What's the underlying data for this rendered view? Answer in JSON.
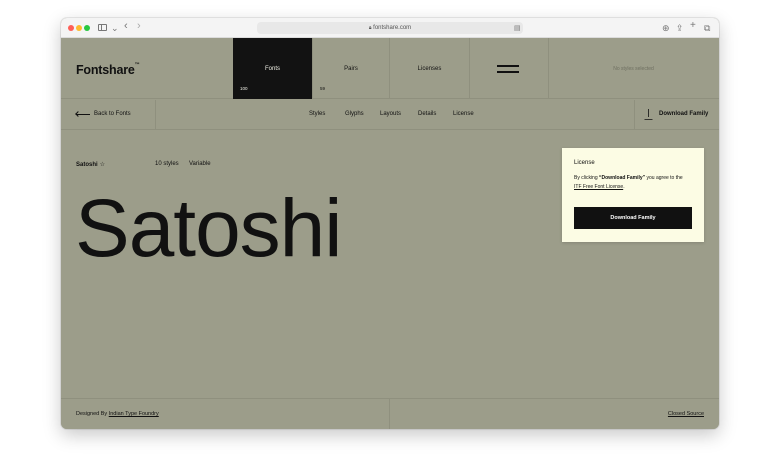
{
  "browser": {
    "url": "fontshare.com"
  },
  "nav": {
    "logo": "Fontshare",
    "logo_mark": "™",
    "fonts_label": "Fonts",
    "fonts_count": "100",
    "pairs_label": "Pairs",
    "pairs_count": "59",
    "licenses_label": "Licenses",
    "no_styles": "No styles selected"
  },
  "subnav": {
    "back_label": "Back to Fonts",
    "tabs": [
      "Styles",
      "Glyphs",
      "Layouts",
      "Details",
      "License"
    ],
    "download_family": "Download Family"
  },
  "font": {
    "name": "Satoshi",
    "styles": "10 styles",
    "variable": "Variable",
    "specimen": "Satoshi"
  },
  "footer": {
    "designed_by": "Designed By",
    "foundry": "Indian Type Foundry",
    "closed_source": "Closed Source"
  },
  "popup": {
    "title": "License",
    "text_pre": "By clicking ",
    "text_bold": "“Download Family”",
    "text_post": " you agree to the",
    "license_link": "ITF Free Font License",
    "text_end": ".",
    "button": "Download Family"
  },
  "colors": {
    "background": "#9c9d8a",
    "active_nav": "#121212",
    "popup_bg": "#fcfce4"
  }
}
